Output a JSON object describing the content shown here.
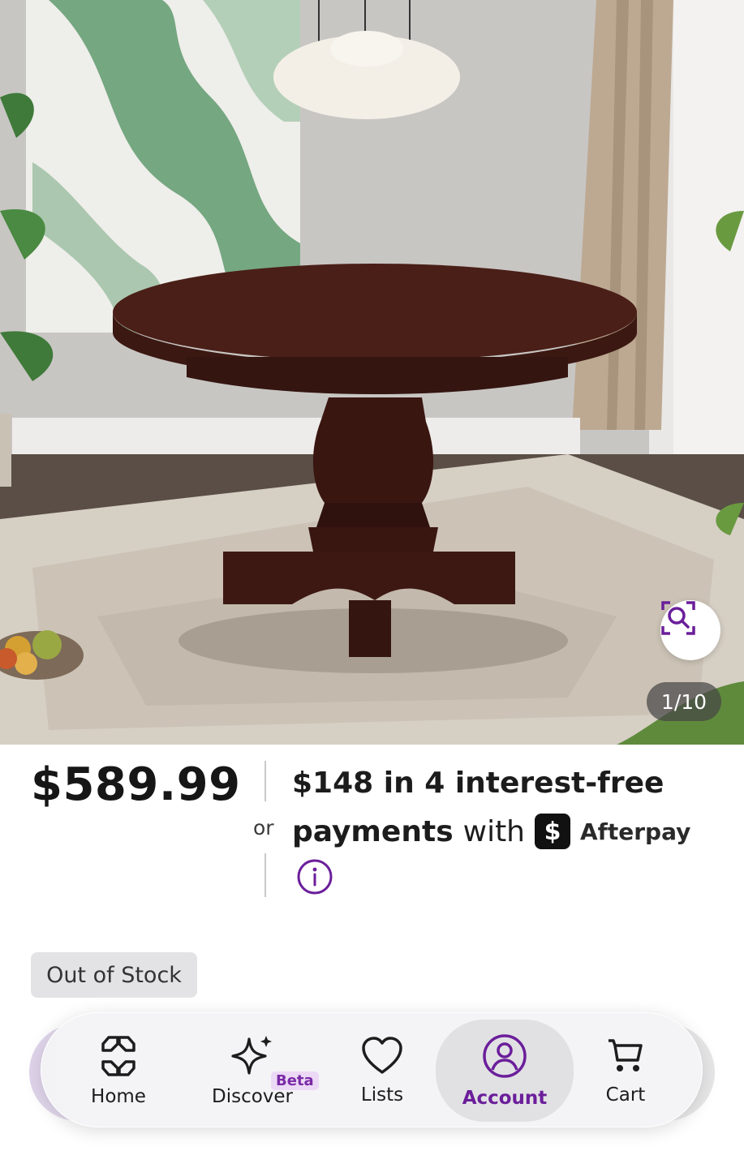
{
  "gallery": {
    "counter": "1/10",
    "zoom_icon": "zoom-search-icon",
    "alt": "Round pedestal dining table"
  },
  "pricing": {
    "price": "$589.99",
    "or": "or",
    "installment_line1": "$148 in 4 interest-free",
    "installment_bold": "payments",
    "installment_with": "with",
    "provider_logo": "$",
    "provider_name": "Afterpay",
    "info_icon": "info-icon"
  },
  "stock": {
    "label": "Out of Stock"
  },
  "nav": {
    "items": [
      {
        "label": "Home",
        "icon": "home-icon"
      },
      {
        "label": "Discover",
        "icon": "sparkle-icon",
        "badge": "Beta"
      },
      {
        "label": "Lists",
        "icon": "heart-icon"
      },
      {
        "label": "Account",
        "icon": "account-icon",
        "active": true
      },
      {
        "label": "Cart",
        "icon": "cart-icon"
      }
    ]
  },
  "colors": {
    "accent": "#6b1e9a",
    "text": "#161616",
    "badge_bg": "#e3e3e5"
  }
}
